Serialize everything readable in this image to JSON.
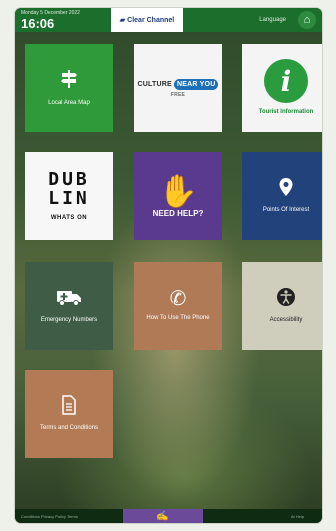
{
  "topbar": {
    "date": "Monday 5 December 2022",
    "time": "16:06",
    "brand": "Clear Channel",
    "language": "Language",
    "icons": {
      "brand": "logo-mark",
      "home": "home-icon"
    }
  },
  "tiles": [
    {
      "id": "local-area-map",
      "label": "Local Area Map",
      "icon": "signpost-icon",
      "color": "#2f9a3a"
    },
    {
      "id": "culture-near-you",
      "label": "",
      "logo_text": "CULTURE",
      "logo_pill": "NEAR YOU",
      "logo_small": "FREE",
      "color": "#f4f4f4"
    },
    {
      "id": "tourist-information",
      "label": "Tourist Information",
      "logo_letter": "i",
      "color": "#f4f4f4"
    },
    {
      "id": "dublin-whats-on",
      "logo_line1": "DUB",
      "logo_line2": "LIN",
      "label": "WHATS ON",
      "color": "#f7f7f7"
    },
    {
      "id": "need-help",
      "label": "NEED HELP?",
      "icon": "hand-icon",
      "color": "#5a3a8e"
    },
    {
      "id": "points-of-interest",
      "label": "Points Of Interest",
      "icon": "location-pin-icon",
      "color": "#21427a"
    },
    {
      "id": "emergency-numbers",
      "label": "Emergency Numbers",
      "icon": "ambulance-icon",
      "color": "#3f5d46"
    },
    {
      "id": "how-to-use-phone",
      "label": "How To Use The Phone",
      "icon": "phone-icon",
      "color": "#b07a57"
    },
    {
      "id": "accessibility",
      "label": "Accessibility",
      "icon": "accessibility-icon",
      "color": "#cfcdbb"
    },
    {
      "id": "terms-and-conditions",
      "label": "Terms and Conditions",
      "icon": "document-icon",
      "color": "#b27b56"
    }
  ],
  "bottombar": {
    "left_text": "Conditions  Privacy Policy  Terms",
    "mid_icon": "signature-icon",
    "right_text": "At Help"
  }
}
